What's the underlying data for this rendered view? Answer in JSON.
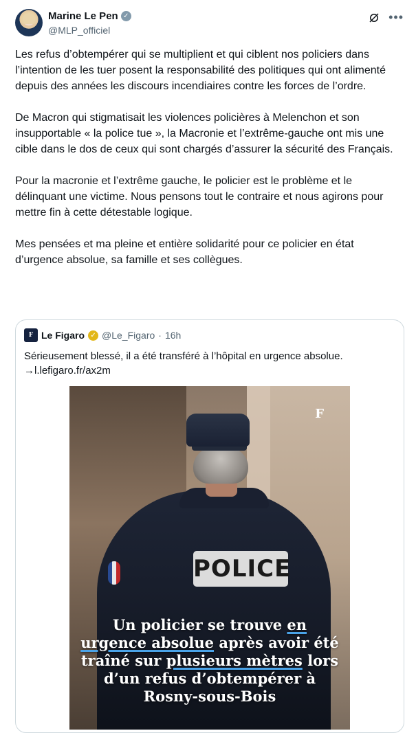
{
  "author": {
    "name": "Marine Le Pen",
    "handle": "@MLP_officiel",
    "verified_color": "#829aab"
  },
  "tweet": {
    "paragraphs": [
      "Les refus d’obtempérer qui se multiplient et qui ciblent nos policiers dans l’intention de les tuer posent la responsabilité des politiques qui ont alimenté depuis des années les discours incendiaires contre les forces de l’ordre.",
      "De Macron qui stigmatisait les violences policières à Melenchon et son insupportable «  la police tue », la Macronie et l’extrême-gauche ont mis une cible dans le dos de ceux qui sont chargés d’assurer la sécurité des Français.",
      "Pour la macronie et l’extrême gauche, le policier est le problème et le délinquant une victime. Nous pensons tout le contraire et nous agirons pour mettre fin à cette détestable logique.",
      "Mes pensées et ma pleine et entière solidarité pour ce policier en état d’urgence absolue, sa famille et ses collègues."
    ]
  },
  "quote": {
    "logo_text": "F",
    "name": "Le Figaro",
    "handle": "@Le_Figaro",
    "separator": "·",
    "time": "16h",
    "text_line1": "Sérieusement blessé, il a été transféré à l’hôpital en urgence absolue.",
    "text_line2": "→l.lefigaro.fr/ax2m",
    "badge_color": "#e2b719",
    "media": {
      "patch_text": "POLICE",
      "watermark": "F",
      "caption_part1": "Un policier se trouve ",
      "caption_ul1": "en urgence absolue",
      "caption_part2": " après avoir été traîné sur ",
      "caption_ul2": "plusieurs mètres",
      "caption_part3": " lors d’un refus d’obtempérer à Rosny-sous-Bois"
    }
  },
  "icons": {
    "grok": "grok-icon",
    "more": "more-icon"
  }
}
